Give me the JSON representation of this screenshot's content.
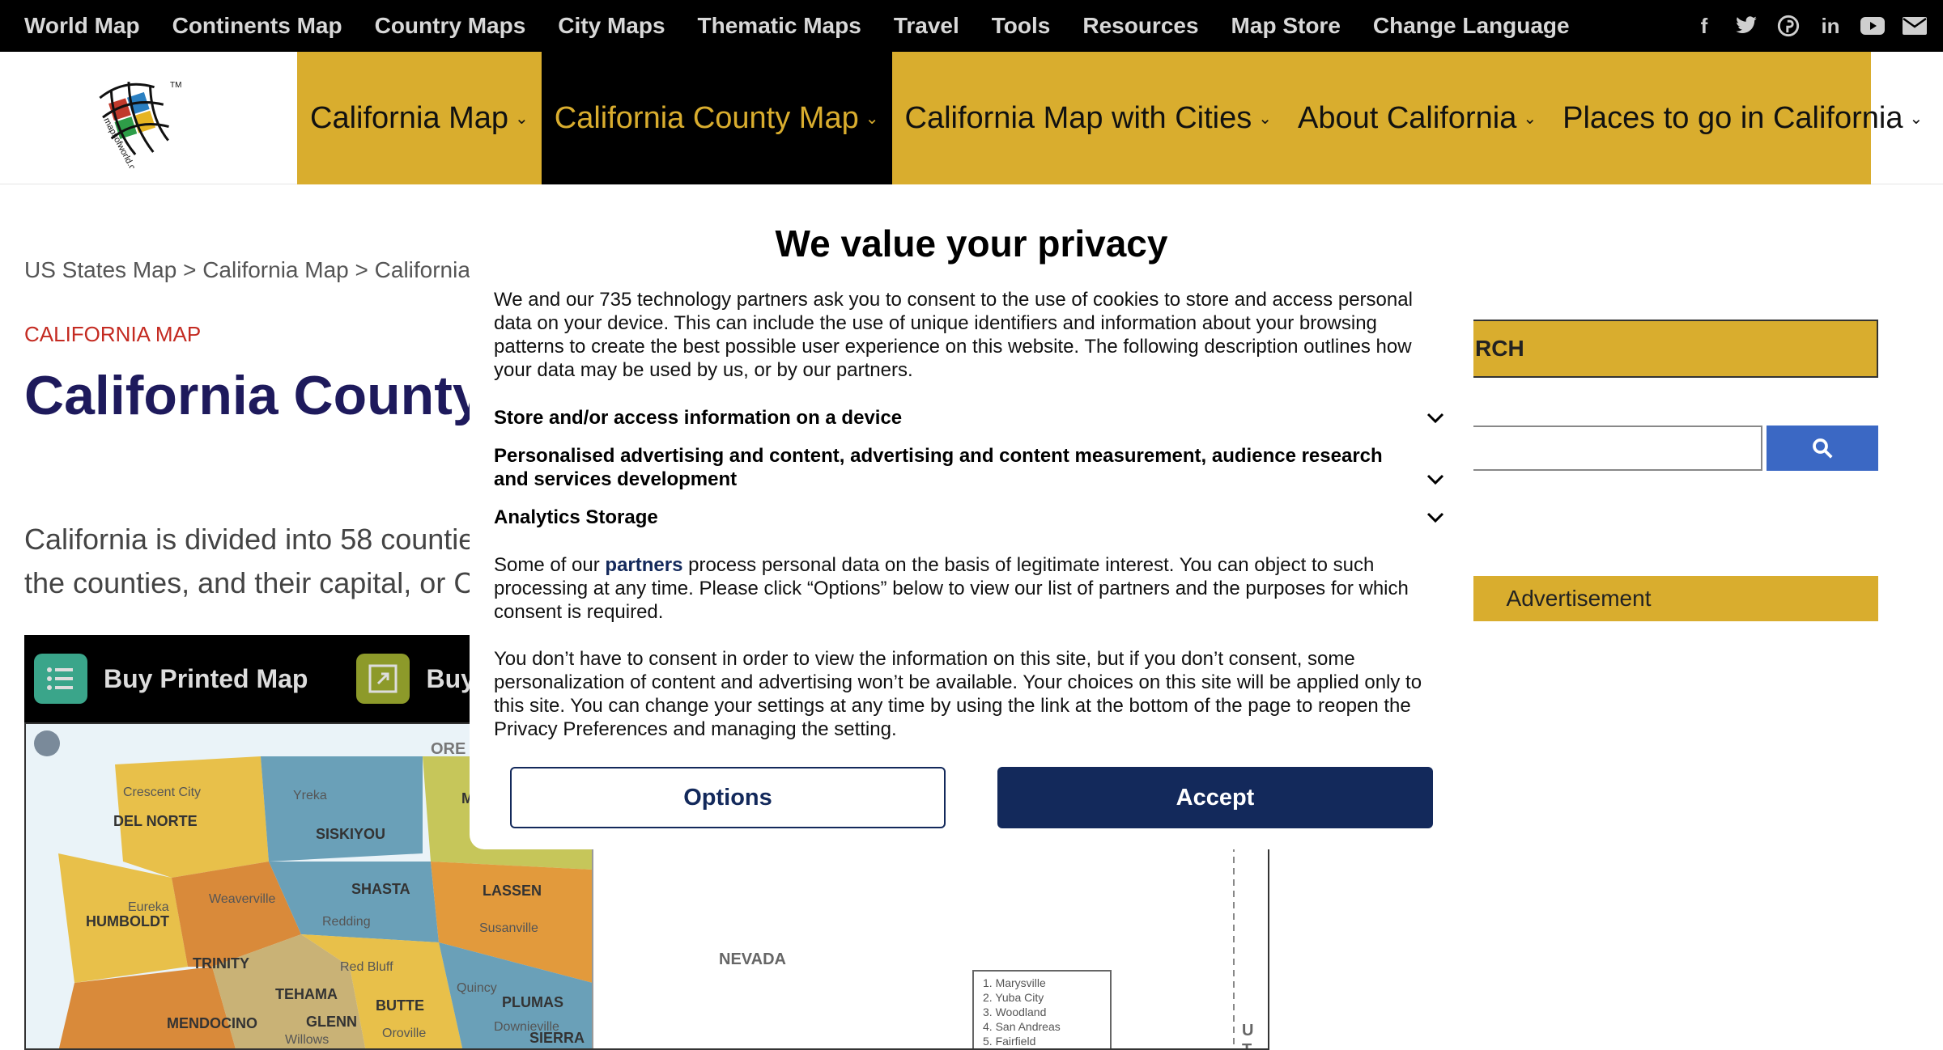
{
  "topnav": {
    "items": [
      "World Map",
      "Continents Map",
      "Country Maps",
      "City Maps",
      "Thematic Maps",
      "Travel",
      "Tools",
      "Resources",
      "Map Store",
      "Change Language"
    ],
    "social": [
      "facebook-icon",
      "twitter-icon",
      "pinterest-icon",
      "linkedin-icon",
      "youtube-icon",
      "mail-icon"
    ]
  },
  "logo": {
    "text": "mapsofworld.com",
    "tm": "TM"
  },
  "mainnav": {
    "items": [
      {
        "label": "California Map",
        "active": false
      },
      {
        "label": "California County Map",
        "active": true
      },
      {
        "label": "California Map with Cities",
        "active": false
      },
      {
        "label": "About California",
        "active": false
      },
      {
        "label": "Places to go in California",
        "active": false
      }
    ],
    "caret": "⌄"
  },
  "page": {
    "breadcrumb": "US States Map > California Map > California",
    "kicker": "CALIFORNIA MAP",
    "title": "California County",
    "intro_line1": "California is divided into 58 countie",
    "intro_line2": "the counties, and their capital, or C",
    "buy_printed": "Buy Printed Map",
    "buy_digital": "Buy Di"
  },
  "map": {
    "labels": [
      "ORE",
      "DEL NORTE",
      "SISKIYOU",
      "SHASTA",
      "LASSEN",
      "HUMBOLDT",
      "TRINITY",
      "TEHAMA",
      "PLUMAS",
      "MENDOCINO",
      "GLENN",
      "BUTTE",
      "SIERRA",
      "NEVADA",
      "M",
      "U",
      "T"
    ],
    "cities": [
      "Crescent City",
      "Yreka",
      "Eureka",
      "Weaverville",
      "Redding",
      "Susanville",
      "Red Bluff",
      "Quincy",
      "Willows",
      "Oroville",
      "Downieville"
    ],
    "legend": [
      "1. Marysville",
      "2. Yuba City",
      "3. Woodland",
      "4. San Andreas",
      "5. Fairfield"
    ]
  },
  "sidebar": {
    "search_heading": "RCH",
    "advertisement": "Advertisement"
  },
  "consent": {
    "title": "We value your privacy",
    "intro": "We and our 735 technology partners ask you to consent to the use of cookies to store and access personal data on your device. This can include the use of unique identifiers and information about your browsing patterns to create the best possible user experience on this website. The following description outlines how your data may be used by us, or by our partners.",
    "purpose1": "Store and/or access information on a device",
    "purpose2": "Personalised advertising and content, advertising and content measurement, audience research and services development",
    "purpose3": "Analytics Storage",
    "legit_pre": "Some of our ",
    "legit_link": "partners",
    "legit_post": " process personal data on the basis of legitimate interest. You can object to such processing at any time. Please click “Options” below to view our list of partners and the purposes for which consent is required.",
    "no_consent": "You don’t have to consent in order to view the information on this site, but if you don’t consent, some personalization of content and advertising won’t be available. Your choices on this site will be applied only to this site. You can change your settings at any time by using the link at the bottom of the page to reopen the Privacy Preferences and managing the setting.",
    "options_label": "Options",
    "accept_label": "Accept"
  },
  "colors": {
    "topbar": "#000000",
    "nav_gold": "#d9ad2e",
    "title_navy": "#1e1a5c",
    "accept_navy": "#13295b",
    "kicker_red": "#c42b22",
    "search_blue": "#3b68c4"
  }
}
